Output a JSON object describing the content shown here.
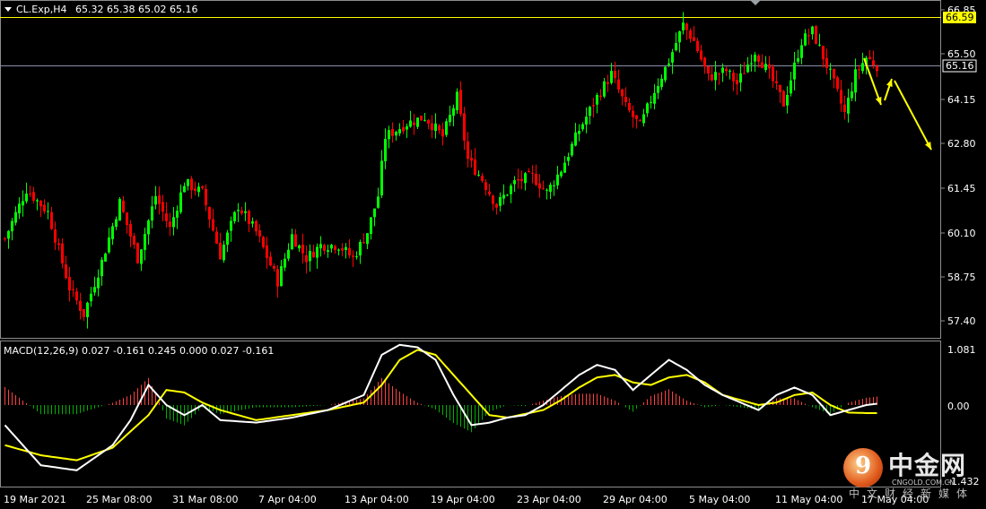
{
  "header": {
    "symbol_label": "CL.Exp,H4",
    "ohlc": "65.32 65.38 65.02 65.16"
  },
  "macd_header": "MACD(12,26,9) 0.027 -0.161 0.245 0.000 0.027 -0.161",
  "price_axis": {
    "ticks": [
      "66.85",
      "65.50",
      "64.15",
      "62.80",
      "61.45",
      "60.10",
      "58.75",
      "57.40"
    ],
    "high_line_label": "66.59",
    "current_price_label": "65.16",
    "high_color": "#ffff00",
    "current_line_color": "#8a8fa8"
  },
  "macd_axis": {
    "ticks": [
      "1.081",
      "0.00",
      "-1.432"
    ]
  },
  "time_axis": [
    "19 Mar 2021",
    "25 Mar 08:00",
    "31 Mar 08:00",
    "7 Apr 04:00",
    "13 Apr 04:00",
    "19 Apr 04:00",
    "23 Apr 04:00",
    "29 Apr 04:00",
    "5 May 04:00",
    "11 May 04:00",
    "17 May 04:00"
  ],
  "colors": {
    "bull": "#00ff00",
    "bear": "#ff0000",
    "macd_line": "#ffffff",
    "signal_line": "#ffff00",
    "arrow": "#ffff00",
    "hist_pos": "#ff4040",
    "hist_neg": "#00b000"
  },
  "watermark": {
    "logo_glyph": "9",
    "brand": "中金网",
    "url": "CNGOLD.COM.CN",
    "sub": "中文财经新媒体"
  },
  "chart_data": {
    "type": "candlestick",
    "symbol": "CL.Exp",
    "timeframe": "H4",
    "ylim": [
      57.0,
      67.3
    ],
    "close_path": [
      [
        0,
        59.9
      ],
      [
        6,
        61.4
      ],
      [
        12,
        60.7
      ],
      [
        18,
        58.4
      ],
      [
        22,
        57.6
      ],
      [
        27,
        59.2
      ],
      [
        32,
        61.0
      ],
      [
        37,
        59.3
      ],
      [
        42,
        61.2
      ],
      [
        46,
        60.2
      ],
      [
        50,
        61.6
      ],
      [
        55,
        61.3
      ],
      [
        60,
        59.4
      ],
      [
        65,
        60.9
      ],
      [
        70,
        60.1
      ],
      [
        76,
        58.6
      ],
      [
        80,
        60.0
      ],
      [
        84,
        59.3
      ],
      [
        88,
        59.7
      ],
      [
        93,
        59.7
      ],
      [
        97,
        59.3
      ],
      [
        101,
        60.1
      ],
      [
        104,
        61.2
      ],
      [
        106,
        63.0
      ],
      [
        112,
        63.4
      ],
      [
        117,
        63.6
      ],
      [
        122,
        63.0
      ],
      [
        126,
        64.2
      ],
      [
        129,
        62.3
      ],
      [
        133,
        61.7
      ],
      [
        137,
        60.9
      ],
      [
        142,
        61.6
      ],
      [
        147,
        61.8
      ],
      [
        151,
        61.3
      ],
      [
        155,
        62.0
      ],
      [
        160,
        63.2
      ],
      [
        165,
        64.2
      ],
      [
        169,
        64.9
      ],
      [
        173,
        63.9
      ],
      [
        177,
        63.3
      ],
      [
        181,
        64.4
      ],
      [
        185,
        65.3
      ],
      [
        189,
        66.4
      ],
      [
        192,
        65.9
      ],
      [
        196,
        64.8
      ],
      [
        201,
        65.0
      ],
      [
        204,
        64.6
      ],
      [
        209,
        65.6
      ],
      [
        213,
        64.9
      ],
      [
        217,
        64.0
      ],
      [
        222,
        65.9
      ],
      [
        225,
        66.2
      ],
      [
        230,
        64.9
      ],
      [
        234,
        63.7
      ],
      [
        237,
        64.9
      ],
      [
        240,
        65.4
      ],
      [
        243,
        65.16
      ]
    ],
    "macd_path": [
      [
        0,
        -0.4
      ],
      [
        10,
        -1.2
      ],
      [
        20,
        -1.3
      ],
      [
        30,
        -0.8
      ],
      [
        35,
        -0.3
      ],
      [
        40,
        0.4
      ],
      [
        45,
        0.0
      ],
      [
        50,
        -0.2
      ],
      [
        55,
        0.0
      ],
      [
        60,
        -0.3
      ],
      [
        70,
        -0.35
      ],
      [
        80,
        -0.25
      ],
      [
        90,
        -0.1
      ],
      [
        100,
        0.2
      ],
      [
        105,
        1.0
      ],
      [
        110,
        1.2
      ],
      [
        115,
        1.15
      ],
      [
        120,
        0.9
      ],
      [
        125,
        0.2
      ],
      [
        130,
        -0.4
      ],
      [
        135,
        -0.35
      ],
      [
        140,
        -0.25
      ],
      [
        145,
        -0.2
      ],
      [
        150,
        0.0
      ],
      [
        155,
        0.3
      ],
      [
        160,
        0.6
      ],
      [
        165,
        0.8
      ],
      [
        170,
        0.7
      ],
      [
        175,
        0.3
      ],
      [
        180,
        0.6
      ],
      [
        185,
        0.9
      ],
      [
        190,
        0.7
      ],
      [
        195,
        0.4
      ],
      [
        200,
        0.2
      ],
      [
        205,
        0.05
      ],
      [
        210,
        -0.1
      ],
      [
        215,
        0.2
      ],
      [
        220,
        0.35
      ],
      [
        225,
        0.2
      ],
      [
        230,
        -0.2
      ],
      [
        235,
        -0.1
      ],
      [
        240,
        0.0
      ],
      [
        243,
        0.027
      ]
    ],
    "signal_path": [
      [
        0,
        -0.8
      ],
      [
        10,
        -1.0
      ],
      [
        20,
        -1.1
      ],
      [
        30,
        -0.85
      ],
      [
        40,
        -0.2
      ],
      [
        45,
        0.3
      ],
      [
        50,
        0.25
      ],
      [
        55,
        0.05
      ],
      [
        60,
        -0.1
      ],
      [
        70,
        -0.3
      ],
      [
        80,
        -0.2
      ],
      [
        90,
        -0.1
      ],
      [
        100,
        0.05
      ],
      [
        105,
        0.4
      ],
      [
        110,
        0.9
      ],
      [
        115,
        1.1
      ],
      [
        120,
        1.0
      ],
      [
        125,
        0.6
      ],
      [
        130,
        0.2
      ],
      [
        135,
        -0.2
      ],
      [
        140,
        -0.25
      ],
      [
        150,
        -0.1
      ],
      [
        155,
        0.1
      ],
      [
        160,
        0.35
      ],
      [
        165,
        0.55
      ],
      [
        170,
        0.6
      ],
      [
        175,
        0.45
      ],
      [
        180,
        0.4
      ],
      [
        185,
        0.55
      ],
      [
        190,
        0.6
      ],
      [
        195,
        0.45
      ],
      [
        200,
        0.2
      ],
      [
        205,
        0.1
      ],
      [
        210,
        0.0
      ],
      [
        215,
        0.05
      ],
      [
        220,
        0.2
      ],
      [
        225,
        0.25
      ],
      [
        230,
        0.0
      ],
      [
        235,
        -0.15
      ],
      [
        240,
        -0.16
      ],
      [
        243,
        -0.161
      ]
    ],
    "macd_range": [
      -1.432,
      1.081
    ],
    "bars": 244,
    "forecast_arrows": [
      "down",
      "up",
      "down"
    ]
  }
}
